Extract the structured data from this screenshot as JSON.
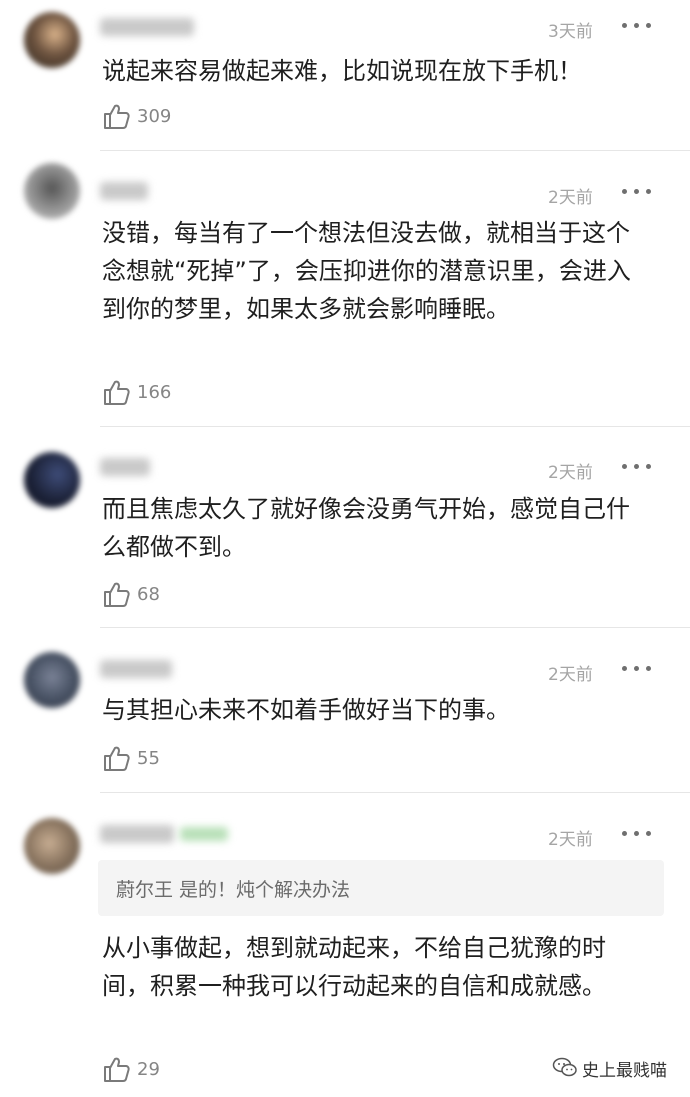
{
  "comments": [
    {
      "time": "3天前",
      "text": "说起来容易做起来难，比如说现在放下手机！",
      "likes": "309",
      "avatar_color": "#4a3a2c"
    },
    {
      "time": "2天前",
      "text": "没错，每当有了一个想法但没去做，就相当于这个念想就“死掉”了，会压抑进你的潜意识里，会进入到你的梦里，如果太多就会影响睡眠。",
      "likes": "166",
      "avatar_color": "#6e6e6e"
    },
    {
      "time": "2天前",
      "text": "而且焦虑太久了就好像会没勇气开始，感觉自己什么都做不到。",
      "likes": "68",
      "avatar_color": "#22283e"
    },
    {
      "time": "2天前",
      "text": "与其担心未来不如着手做好当下的事。",
      "likes": "55",
      "avatar_color": "#4a5466"
    },
    {
      "time": "2天前",
      "quote": "蔚尔王 是的！炖个解决办法",
      "text": "从小事做起，想到就动起来，不给自己犹豫的时间，积累一种我可以行动起来的自信和成就感。",
      "likes": "29",
      "avatar_color": "#8a7560"
    }
  ],
  "watermark": {
    "text": "史上最贱喵"
  },
  "icons": {
    "like": "thumbs-up-icon",
    "more": "more-dots-icon",
    "watermark": "wechat-icon"
  }
}
